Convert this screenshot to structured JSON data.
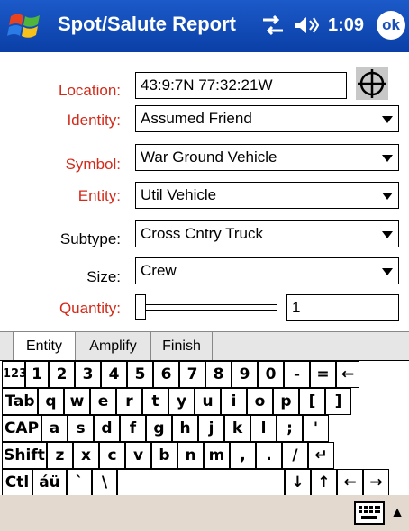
{
  "titlebar": {
    "title": "Spot/Salute Report",
    "time": "1:09",
    "ok_label": "ok",
    "icons": [
      "windows-logo-icon",
      "connectivity-icon",
      "speaker-icon"
    ]
  },
  "form": {
    "location_label": "Location:",
    "location_value": "43:9:7N 77:32:21W",
    "identity_label": "Identity:",
    "identity_value": "Assumed Friend",
    "symbol_label": "Symbol:",
    "symbol_value": "War Ground Vehicle",
    "entity_label": "Entity:",
    "entity_value": "Util Vehicle",
    "subtype_label": "Subtype:",
    "subtype_value": "Cross Cntry Truck",
    "size_label": "Size:",
    "size_value": "Crew",
    "quantity_label": "Quantity:",
    "quantity_value": "1"
  },
  "tabs": [
    "Entity",
    "Amplify",
    "Finish"
  ],
  "keyboard": {
    "rows": [
      [
        "123",
        "1",
        "2",
        "3",
        "4",
        "5",
        "6",
        "7",
        "8",
        "9",
        "0",
        "-",
        "=",
        "←"
      ],
      [
        "Tab",
        "q",
        "w",
        "e",
        "r",
        "t",
        "y",
        "u",
        "i",
        "o",
        "p",
        "[",
        "]"
      ],
      [
        "CAP",
        "a",
        "s",
        "d",
        "f",
        "g",
        "h",
        "j",
        "k",
        "l",
        ";",
        "'"
      ],
      [
        "Shift",
        "z",
        "x",
        "c",
        "v",
        "b",
        "n",
        "m",
        ",",
        ".",
        "/",
        "↵"
      ],
      [
        "Ctl",
        "áü",
        "`",
        "\\",
        "",
        "↓",
        "↑",
        "←",
        "→"
      ]
    ]
  },
  "colors": {
    "title_bar": "#0d44ad",
    "required_label": "#d22b1a",
    "bottom_bar": "#e4d9ce",
    "tab_bar": "#e6e6e6"
  }
}
